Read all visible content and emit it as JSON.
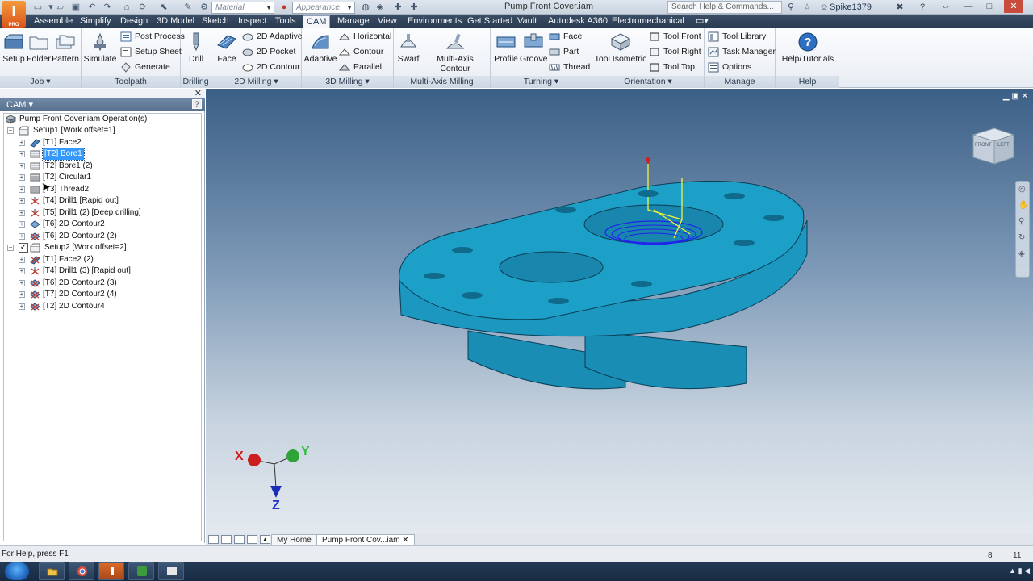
{
  "titlebar": {
    "app_logo_letter": "I",
    "app_logo_sub": "PRO",
    "material_placeholder": "Material",
    "appearance_placeholder": "Appearance",
    "document_title": "Pump Front Cover.iam",
    "search_placeholder": "Search Help & Commands...",
    "username": "Spike1379"
  },
  "menu_tabs": [
    "Assemble",
    "Simplify",
    "Design",
    "3D Model",
    "Sketch",
    "Inspect",
    "Tools",
    "CAM",
    "Manage",
    "View",
    "Environments",
    "Get Started",
    "Vault",
    "Autodesk A360",
    "Electromechanical"
  ],
  "active_tab": "CAM",
  "ribbon": {
    "job": {
      "label": "Job",
      "setup": "Setup",
      "folder": "Folder",
      "pattern": "Pattern"
    },
    "toolpath": {
      "label": "Toolpath",
      "simulate": "Simulate",
      "post_process": "Post Process",
      "setup_sheet": "Setup Sheet",
      "generate": "Generate"
    },
    "drilling": {
      "label": "Drilling",
      "drill": "Drill"
    },
    "milling2d": {
      "label": "2D Milling",
      "face": "Face",
      "adaptive2d": "2D Adaptive",
      "pocket2d": "2D Pocket",
      "contour2d": "2D Contour"
    },
    "milling3d": {
      "label": "3D Milling",
      "adaptive": "Adaptive",
      "horizontal": "Horizontal",
      "contour": "Contour",
      "parallel": "Parallel"
    },
    "multiaxis": {
      "label": "Multi-Axis Milling",
      "swarf": "Swarf",
      "multi_axis_contour": "Multi-Axis Contour"
    },
    "turning": {
      "label": "Turning",
      "profile": "Profile",
      "groove": "Groove",
      "face": "Face",
      "part": "Part",
      "thread": "Thread"
    },
    "orientation": {
      "label": "Orientation",
      "tool_isometric": "Tool Isometric",
      "tool_front": "Tool Front",
      "tool_right": "Tool Right",
      "tool_top": "Tool Top"
    },
    "manage": {
      "label": "Manage",
      "tool_library": "Tool Library",
      "task_manager": "Task Manager",
      "options": "Options"
    },
    "help": {
      "label": "Help",
      "help_tutorials": "Help/Tutorials"
    }
  },
  "browser": {
    "title": "CAM",
    "root": "Pump Front Cover.iam Operation(s)",
    "setups": [
      {
        "name": "Setup1 [Work offset=1]",
        "ops": [
          "[T1] Face2",
          "[T2] Bore1",
          "[T2] Bore1 (2)",
          "[T2] Circular1",
          "[T3] Thread2",
          "[T4] Drill1 [Rapid out]",
          "[T5] Drill1 (2) [Deep drilling]",
          "[T6] 2D Contour2",
          "[T6] 2D Contour2 (2)"
        ]
      },
      {
        "name": "Setup2 [Work offset=2]",
        "ops": [
          "[T1] Face2 (2)",
          "[T4] Drill1 (3) [Rapid out]",
          "[T6] 2D Contour2 (3)",
          "[T7] 2D Contour2 (4)",
          "[T2] 2D Contour4"
        ]
      }
    ],
    "selected_op": "[T2] Bore1"
  },
  "viewport": {
    "axis_x": "X",
    "axis_y": "Y",
    "axis_z": "Z",
    "viewcube_front": "FRONT",
    "viewcube_left": "LEFT"
  },
  "doc_tabs": [
    "My Home",
    "Pump Front Cov...iam"
  ],
  "status": {
    "help_text": "For Help, press F1",
    "num1": "8",
    "num2": "11"
  },
  "colors": {
    "part": "#1ca0c8",
    "accent": "#3399ff",
    "ribbon_tab_bar": "#2f4259"
  }
}
